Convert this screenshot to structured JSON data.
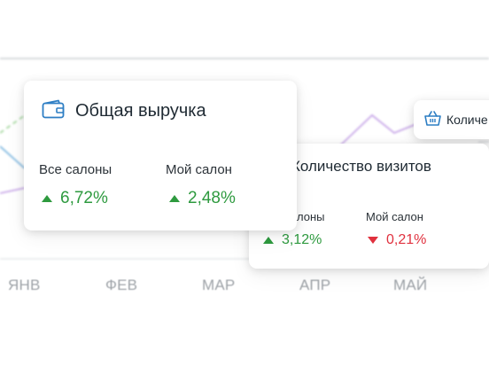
{
  "months": [
    "ЯНВ",
    "ФЕВ",
    "МАР",
    "АПР",
    "МАЙ"
  ],
  "colors": {
    "accent": "#2d7ec4",
    "up": "#2e9a3f",
    "down": "#e0313e",
    "text": "#1f2a33",
    "muted": "#9ea3a8"
  },
  "revenue_card": {
    "icon": "wallet-icon",
    "title": "Общая выручка",
    "stats": [
      {
        "label": "Все салоны",
        "value": "6,72%",
        "direction": "up"
      },
      {
        "label": "Мой салон",
        "value": "2,48%",
        "direction": "up"
      }
    ]
  },
  "visits_card": {
    "icon": "user-icon",
    "title": "Количество визитов",
    "stats": [
      {
        "label": "лоны",
        "value": "3,12%",
        "direction": "up"
      },
      {
        "label": "Мой салон",
        "value": "0,21%",
        "direction": "down"
      }
    ]
  },
  "third_card": {
    "icon": "basket-icon",
    "title": "Количе"
  }
}
